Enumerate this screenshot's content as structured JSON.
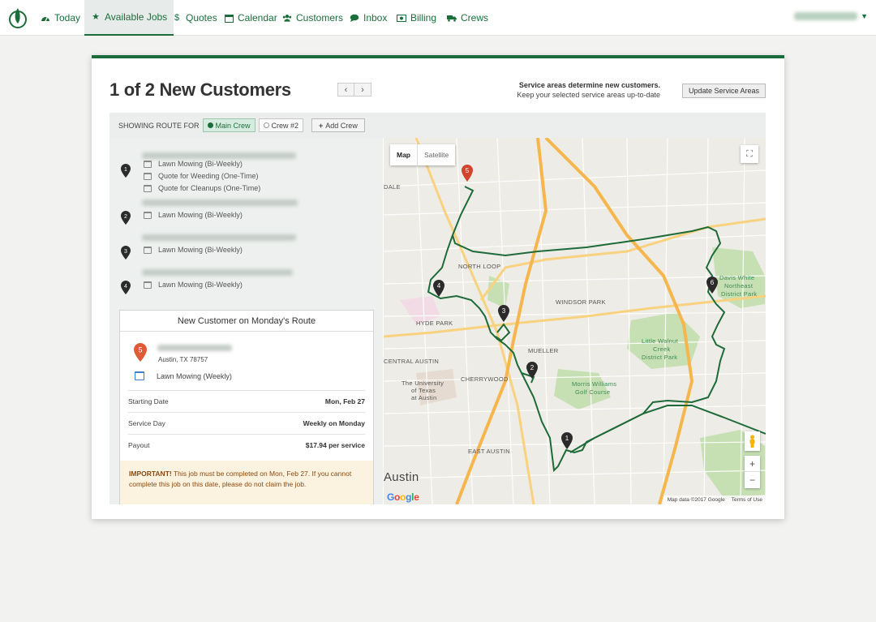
{
  "nav": {
    "items": [
      {
        "label": "Today",
        "icon": "dashboard-icon"
      },
      {
        "label": "Available Jobs",
        "icon": "star-icon"
      },
      {
        "label": "Quotes",
        "icon": "dollar-icon"
      },
      {
        "label": "Calendar",
        "icon": "calendar-icon"
      },
      {
        "label": "Customers",
        "icon": "users-icon"
      },
      {
        "label": "Inbox",
        "icon": "chat-icon"
      },
      {
        "label": "Billing",
        "icon": "billing-icon"
      },
      {
        "label": "Crews",
        "icon": "truck-icon"
      }
    ],
    "active": "Available Jobs"
  },
  "header": {
    "title": "1 of 2 New Customers",
    "service_note_bold": "Service areas determine new customers.",
    "service_note": "Keep your selected service areas up-to-date",
    "update_button": "Update Service Areas"
  },
  "routebar": {
    "label": "SHOWING ROUTE FOR",
    "crews": [
      "Main Crew",
      "Crew #2"
    ],
    "selected_crew": "Main Crew",
    "add_crew": "Add Crew"
  },
  "stops": [
    {
      "number": "1",
      "services": [
        "Lawn Mowing  (Bi-Weekly)",
        "Quote for Weeding  (One-Time)",
        "Quote for Cleanups  (One-Time)"
      ]
    },
    {
      "number": "2",
      "services": [
        "Lawn Mowing  (Bi-Weekly)"
      ]
    },
    {
      "number": "3",
      "services": [
        "Lawn Mowing  (Bi-Weekly)"
      ]
    },
    {
      "number": "4",
      "services": [
        "Lawn Mowing  (Bi-Weekly)"
      ]
    }
  ],
  "new_customer": {
    "heading": "New Customer on Monday's Route",
    "pin_number": "5",
    "city": "Austin, TX 78757",
    "service": "Lawn Mowing (Weekly)",
    "rows": [
      {
        "label": "Starting Date",
        "value": "Mon, Feb 27"
      },
      {
        "label": "Service Day",
        "value": "Weekly on Monday"
      },
      {
        "label": "Payout",
        "value": "$17.94 per service"
      }
    ],
    "important_label": "IMPORTANT!",
    "important_text": " This job must be completed on Mon, Feb 27. If you cannot complete this job on this date, please do not claim the job."
  },
  "map": {
    "tabs": [
      "Map",
      "Satellite"
    ],
    "attribution": "Map data ©2017 Google",
    "terms": "Terms of Use",
    "brand": "Google",
    "zoom_in": "+",
    "zoom_out": "−",
    "labels": [
      {
        "text": "NORTH LOOP",
        "green": false
      },
      {
        "text": "WINDSOR PARK",
        "green": false
      },
      {
        "text": "HYDE PARK",
        "green": false
      },
      {
        "text": "MUELLER",
        "green": false
      },
      {
        "text": "CHERRYWOOD",
        "green": false
      },
      {
        "text": "CENTRAL AUSTIN",
        "green": false
      },
      {
        "text": "EAST AUSTIN",
        "green": false
      },
      {
        "text": "Little Walnut",
        "green": true
      },
      {
        "text": "Creek",
        "green": true
      },
      {
        "text": "District Park",
        "green": true
      },
      {
        "text": "Davis White",
        "green": true
      },
      {
        "text": "Northeast",
        "green": true
      },
      {
        "text": "District Park",
        "green": true
      },
      {
        "text": "Morris Williams",
        "green": true
      },
      {
        "text": "Golf Course",
        "green": true
      },
      {
        "text": "The University",
        "green": false
      },
      {
        "text": "of Texas",
        "green": false
      },
      {
        "text": "at Austin",
        "green": false
      },
      {
        "text": "DALE",
        "green": false
      },
      {
        "text": "Austin",
        "green": false
      }
    ],
    "markers": [
      "1",
      "2",
      "3",
      "4",
      "5",
      "6"
    ],
    "route_color": "#1e6b3a",
    "new_marker_color": "#d2432e"
  },
  "colors": {
    "brand": "#1b6e3c",
    "accent_blue": "#3b82c4"
  }
}
